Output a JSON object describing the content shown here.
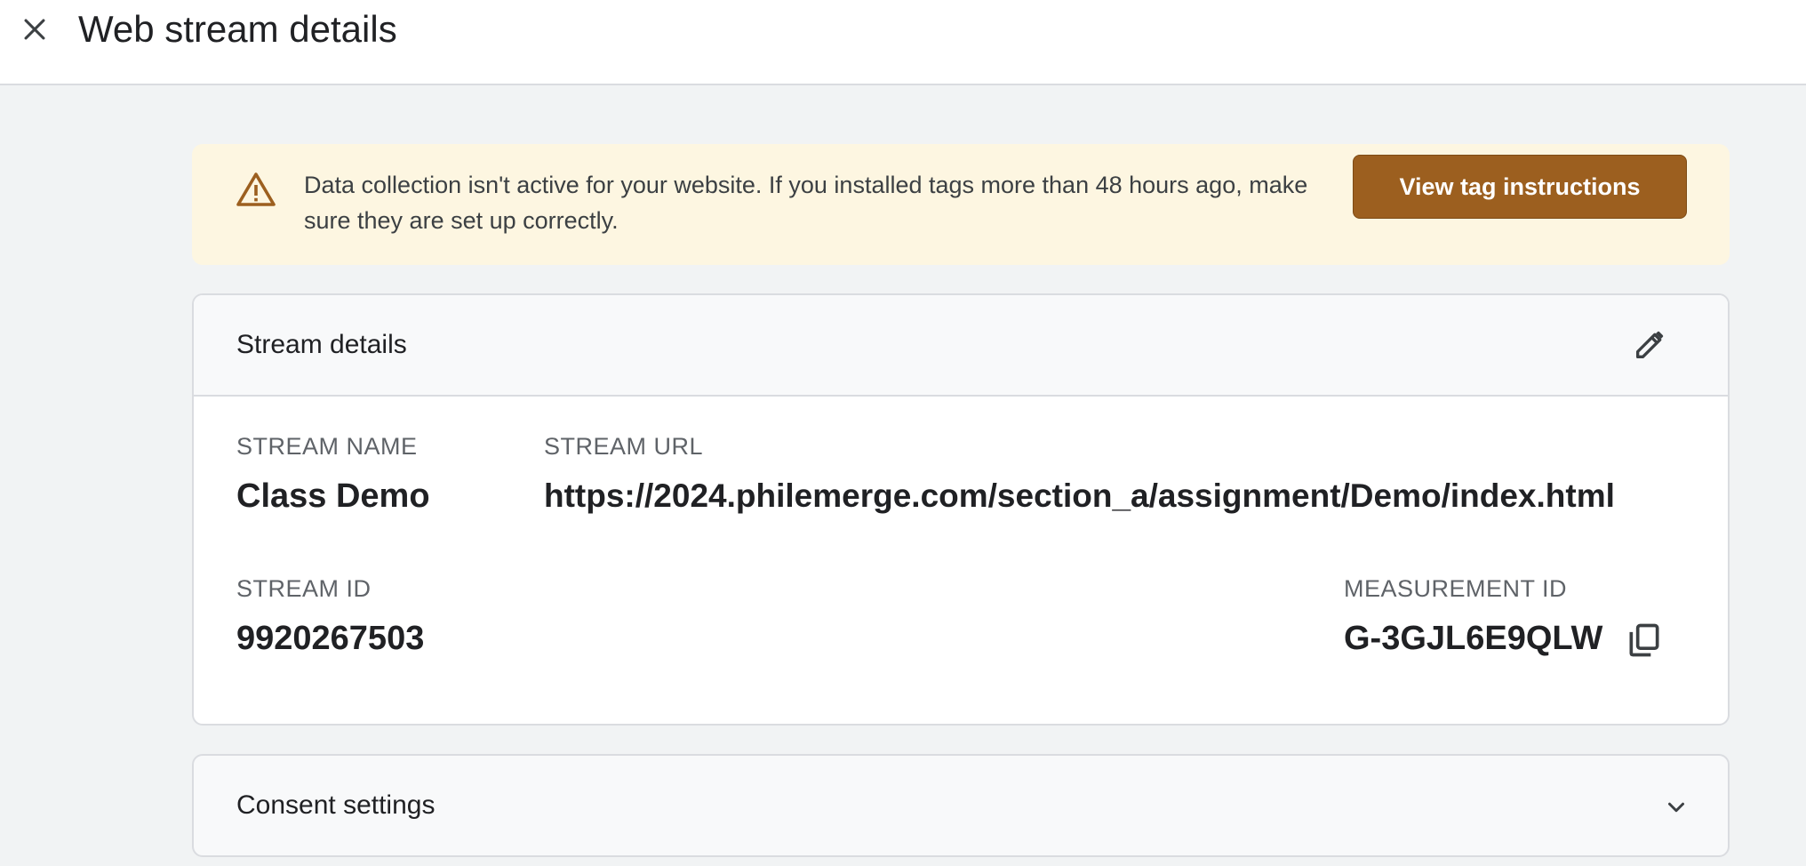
{
  "header": {
    "title": "Web stream details"
  },
  "alert": {
    "message": "Data collection isn't active for your website. If you installed tags more than 48 hours ago, make sure they are set up correctly.",
    "button_label": "View tag instructions",
    "icon": "warning-icon",
    "accent_color": "#9c5f1f",
    "background_color": "#fdf6e1"
  },
  "stream_details": {
    "title": "Stream details",
    "edit_icon": "pencil-icon",
    "fields": {
      "stream_name": {
        "label": "STREAM NAME",
        "value": "Class Demo"
      },
      "stream_url": {
        "label": "STREAM URL",
        "value": "https://2024.philemerge.com/section_a/assignment/Demo/index.html"
      },
      "stream_id": {
        "label": "STREAM ID",
        "value": "9920267503"
      },
      "measurement_id": {
        "label": "MEASUREMENT ID",
        "value": "G-3GJL6E9QLW"
      }
    },
    "copy_icon": "copy-icon"
  },
  "consent": {
    "title": "Consent settings",
    "chevron_icon": "chevron-down-icon"
  }
}
